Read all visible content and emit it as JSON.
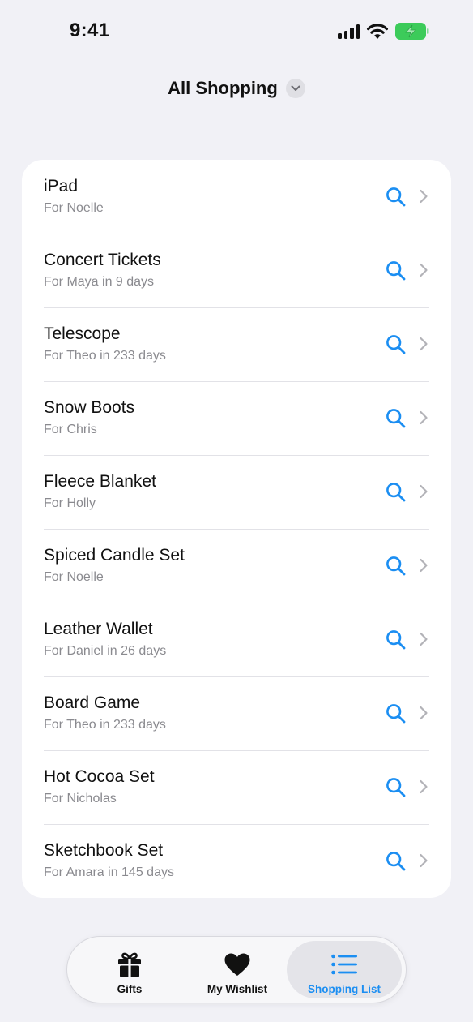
{
  "status_bar": {
    "time": "9:41",
    "icons": [
      "signal-icon",
      "wifi-icon",
      "battery-charging-icon"
    ],
    "battery_color": "#3ccb5a"
  },
  "header": {
    "title": "All Shopping",
    "dropdown_icon": "chevron-down-icon"
  },
  "items": [
    {
      "title": "iPad",
      "subtitle": "For Noelle"
    },
    {
      "title": "Concert Tickets",
      "subtitle": "For Maya in 9 days"
    },
    {
      "title": "Telescope",
      "subtitle": "For Theo in 233 days"
    },
    {
      "title": "Snow Boots",
      "subtitle": "For Chris"
    },
    {
      "title": "Fleece Blanket",
      "subtitle": "For Holly"
    },
    {
      "title": "Spiced Candle Set",
      "subtitle": "For Noelle"
    },
    {
      "title": "Leather Wallet",
      "subtitle": "For Daniel in 26 days"
    },
    {
      "title": "Board Game",
      "subtitle": "For Theo in 233 days"
    },
    {
      "title": "Hot Cocoa Set",
      "subtitle": "For Nicholas"
    },
    {
      "title": "Sketchbook Set",
      "subtitle": "For Amara in 145 days"
    }
  ],
  "row_icons": {
    "search": "search-icon",
    "chevron": "chevron-right-icon"
  },
  "tabs": [
    {
      "label": "Gifts",
      "icon": "gift-icon",
      "active": false
    },
    {
      "label": "My Wishlist",
      "icon": "heart-icon",
      "active": false
    },
    {
      "label": "Shopping List",
      "icon": "list-icon",
      "active": true
    }
  ],
  "colors": {
    "accent": "#1b8ef2",
    "background": "#f1f1f6",
    "card": "#ffffff",
    "secondary_text": "#8a8a8f"
  }
}
